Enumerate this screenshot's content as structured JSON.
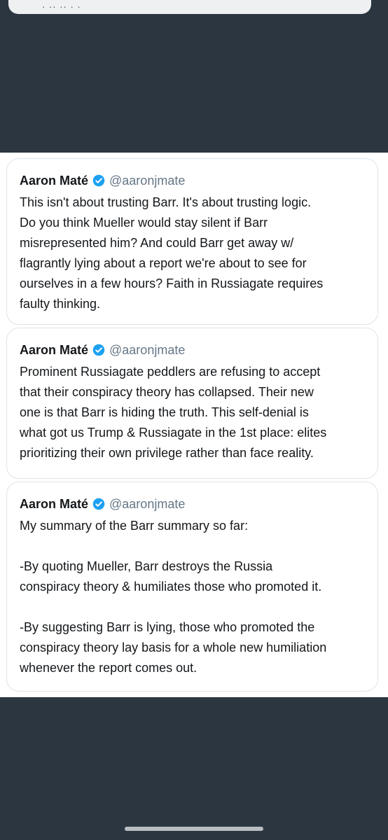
{
  "top_card": {
    "text": "· ·· ·· · ·"
  },
  "tweets": [
    {
      "author": "Aaron Maté",
      "handle": "@aaronjmate",
      "text": "This isn't about trusting Barr. It's about trusting logic.\nDo you think Mueller would stay silent if Barr\nmisrepresented him? And could Barr get away w/\nflagrantly lying about a report we're about to see for\nourselves in a few hours? Faith in Russiagate requires\nfaulty thinking."
    },
    {
      "author": "Aaron Maté",
      "handle": "@aaronjmate",
      "text": "Prominent Russiagate peddlers are refusing to accept\nthat their conspiracy theory has collapsed. Their new\none is that Barr is hiding the truth. This self-denial is\nwhat got us Trump & Russiagate in the 1st place: elites\nprioritizing their own privilege rather than face reality."
    },
    {
      "author": "Aaron Maté",
      "handle": "@aaronjmate",
      "text": "My summary of the Barr summary so far:\n\n-By quoting Mueller, Barr destroys the Russia\nconspiracy theory & humiliates those who promoted it.\n\n-By suggesting Barr is lying, those who promoted the\nconspiracy theory lay basis for a whole new humiliation\nwhenever the report comes out."
    }
  ],
  "icons": {
    "verified": "verified-badge-icon"
  },
  "colors": {
    "background": "#2b3640",
    "verified": "#1da1f2",
    "handle": "#657786"
  }
}
